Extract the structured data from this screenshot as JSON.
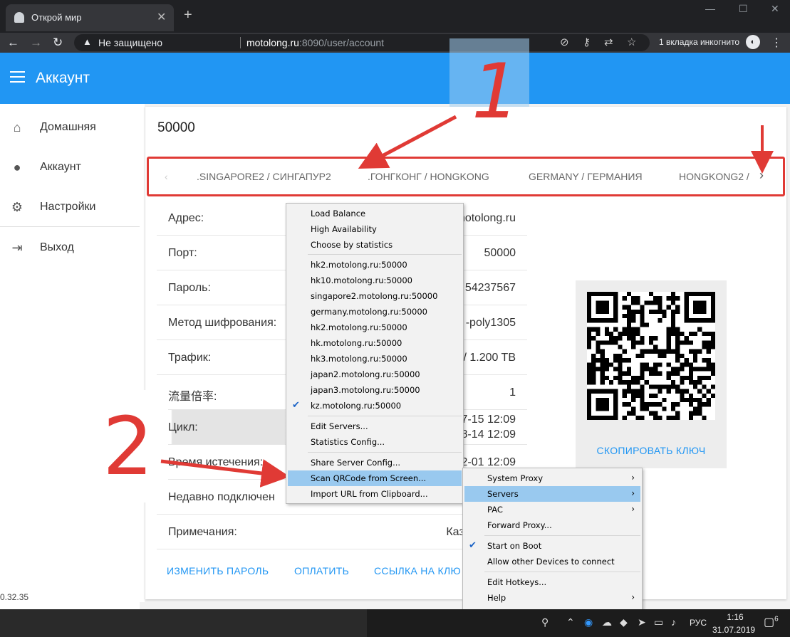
{
  "browser": {
    "tab_title": "Открой мир",
    "new_tab": "+",
    "security_label": "Не защищено",
    "url_host": "motolong.ru",
    "url_path": ":8090/user/account",
    "incognito_label": "1 вкладка инкогнито"
  },
  "app": {
    "title": "Аккаунт",
    "accent_color": "#2196f3"
  },
  "sidebar": {
    "items": [
      {
        "label": "Домашняя",
        "icon": "home-icon"
      },
      {
        "label": "Аккаунт",
        "icon": "account-circle-icon"
      },
      {
        "label": "Настройки",
        "icon": "gear-icon"
      },
      {
        "label": "Выход",
        "icon": "logout-icon"
      }
    ],
    "version": "0.32.35"
  },
  "account": {
    "port_title": "50000",
    "server_tabs": [
      ".SINGAPORE2 / СИНГАПУР2",
      ".ГОНГКОНГ / HONGKONG",
      "GERMANY / ГЕРМАНИЯ",
      "HONGKONG2 /"
    ],
    "rows": [
      {
        "key": "Адрес:",
        "value": "motolong.ru"
      },
      {
        "key": "Порт:",
        "value": "50000"
      },
      {
        "key": "Пароль:",
        "value": "54237567"
      },
      {
        "key": "Метод шифрования:",
        "value": "-poly1305"
      },
      {
        "key": "Трафик:",
        "value": "/ 1.200 TB"
      },
      {
        "key": "流量倍率:",
        "value": "1"
      },
      {
        "key": "Цикл:",
        "value": "7-15 12:09",
        "value2": "8-14 12:09"
      },
      {
        "key": "Время истечения:",
        "value": "2-01 12:09"
      },
      {
        "key": "Недавно подключен",
        "value": ""
      },
      {
        "key": "Примечания:",
        "value": "Казахстан / К"
      }
    ],
    "copy_key": "СКОПИРОВАТЬ КЛЮЧ",
    "actions": [
      "ИЗМЕНИТЬ ПАРОЛЬ",
      "ОПЛАТИТЬ",
      "ССЫЛКА НА КЛЮ"
    ]
  },
  "servers_menu": {
    "items": [
      {
        "label": "Load Balance"
      },
      {
        "label": "High Availability"
      },
      {
        "label": "Choose by statistics"
      },
      {
        "label": "hk2.motolong.ru:50000"
      },
      {
        "label": "hk10.motolong.ru:50000"
      },
      {
        "label": "singapore2.motolong.ru:50000"
      },
      {
        "label": "germany.motolong.ru:50000"
      },
      {
        "label": "hk2.motolong.ru:50000"
      },
      {
        "label": "hk.motolong.ru:50000"
      },
      {
        "label": "hk3.motolong.ru:50000"
      },
      {
        "label": "japan2.motolong.ru:50000"
      },
      {
        "label": "japan3.motolong.ru:50000"
      },
      {
        "label": "kz.motolong.ru:50000",
        "checked": true
      },
      {
        "label": "Edit Servers..."
      },
      {
        "label": "Statistics Config..."
      },
      {
        "label": "Share Server Config..."
      },
      {
        "label": "Scan QRCode from Screen...",
        "highlighted": true
      },
      {
        "label": "Import URL from Clipboard..."
      }
    ]
  },
  "tray_menu": {
    "items": [
      {
        "label": "System Proxy",
        "submenu": true
      },
      {
        "label": "Servers",
        "submenu": true,
        "highlighted": true
      },
      {
        "label": "PAC",
        "submenu": true
      },
      {
        "label": "Forward Proxy..."
      },
      {
        "label": "Start on Boot",
        "checked": true
      },
      {
        "label": "Allow other Devices to connect"
      },
      {
        "label": "Edit Hotkeys..."
      },
      {
        "label": "Help",
        "submenu": true
      }
    ]
  },
  "annotations": {
    "one": "1",
    "two": "2",
    "color": "#e03a35"
  },
  "taskbar": {
    "lang": "РУС",
    "time": "1:16",
    "date": "31.07.2019",
    "notif_count": "6"
  }
}
